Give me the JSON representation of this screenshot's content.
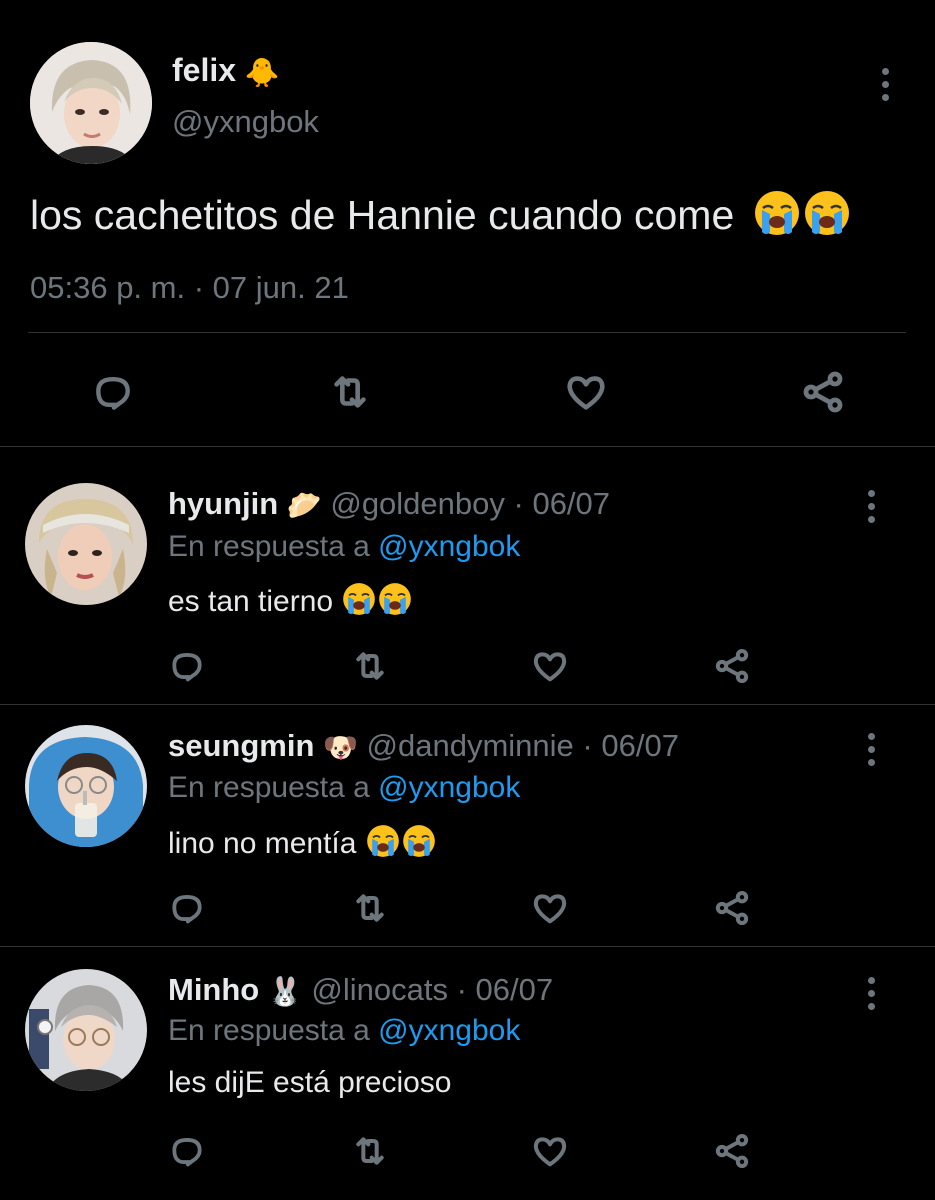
{
  "main_tweet": {
    "author_name": "felix",
    "author_emoji": "🐥",
    "handle": "@yxngbok",
    "text": "los cachetitos de Hannie cuando come",
    "timestamp": "05:36 p. m. · 07 jun. 21",
    "icons": [
      "reply-icon",
      "retweet-icon",
      "like-icon",
      "share-icon",
      "more-options-icon"
    ]
  },
  "replies": [
    {
      "name": "hyunjin",
      "emoji": "🥟",
      "handle": "@goldenboy",
      "date": "· 06/07",
      "reply_prefix": "En respuesta a",
      "reply_to": "@yxngbok",
      "text": "es tan tierno"
    },
    {
      "name": "seungmin",
      "emoji": "🐶",
      "handle": "@dandyminnie",
      "date": "· 06/07",
      "reply_prefix": "En respuesta a",
      "reply_to": "@yxngbok",
      "text": "lino no mentía"
    },
    {
      "name": "Minho",
      "emoji": "🐰",
      "handle": "@linocats",
      "date": "· 06/07",
      "reply_prefix": "En respuesta a",
      "reply_to": "@yxngbok",
      "text": "les dijE está precioso"
    }
  ],
  "colors": {
    "background": "#000000",
    "text": "#e7e9ea",
    "secondary": "#6e767d",
    "link": "#1d9bf0",
    "divider": "#2f3336"
  }
}
